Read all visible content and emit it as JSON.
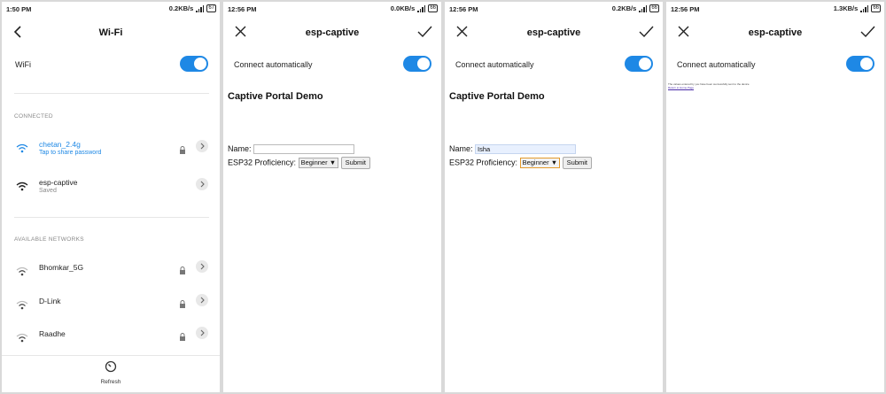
{
  "screens": [
    {
      "status": {
        "time": "1:50 PM",
        "speed": "0.2KB/s",
        "battery": "67"
      },
      "title": "Wi-Fi",
      "wifi_label": "WiFi",
      "connected_header": "CONNECTED",
      "connected": [
        {
          "name": "chetan_2.4g",
          "sub": "Tap to share password",
          "active": true,
          "locked": true
        },
        {
          "name": "esp-captive",
          "sub": "Saved",
          "active": false,
          "locked": false
        }
      ],
      "available_header": "AVAILABLE NETWORKS",
      "available": [
        {
          "name": "Bhomkar_5G"
        },
        {
          "name": "D-Link"
        },
        {
          "name": "Raadhe"
        }
      ],
      "refresh_label": "Refresh"
    },
    {
      "status": {
        "time": "12:56 PM",
        "speed": "0.0KB/s",
        "battery": "66"
      },
      "title": "esp-captive",
      "auto_label": "Connect automatically",
      "portal_title": "Captive Portal Demo",
      "name_label": "Name:",
      "name_value": "",
      "proficiency_label": "ESP32 Proficiency:",
      "proficiency_value": "Beginner",
      "submit_label": "Submit"
    },
    {
      "status": {
        "time": "12:56 PM",
        "speed": "0.2KB/s",
        "battery": "66"
      },
      "title": "esp-captive",
      "auto_label": "Connect automatically",
      "portal_title": "Captive Portal Demo",
      "name_label": "Name:",
      "name_value": "Isha",
      "proficiency_label": "ESP32 Proficiency:",
      "proficiency_value": "Beginner",
      "submit_label": "Submit"
    },
    {
      "status": {
        "time": "12:56 PM",
        "speed": "1.3KB/s",
        "battery": "66"
      },
      "title": "esp-captive",
      "auto_label": "Connect automatically",
      "message": "The values entered by you have been successfully sent to the device",
      "return_link": "Return to Home Page"
    }
  ],
  "colors": {
    "accent": "#1e88e5",
    "active_network": "#1e88e5"
  }
}
